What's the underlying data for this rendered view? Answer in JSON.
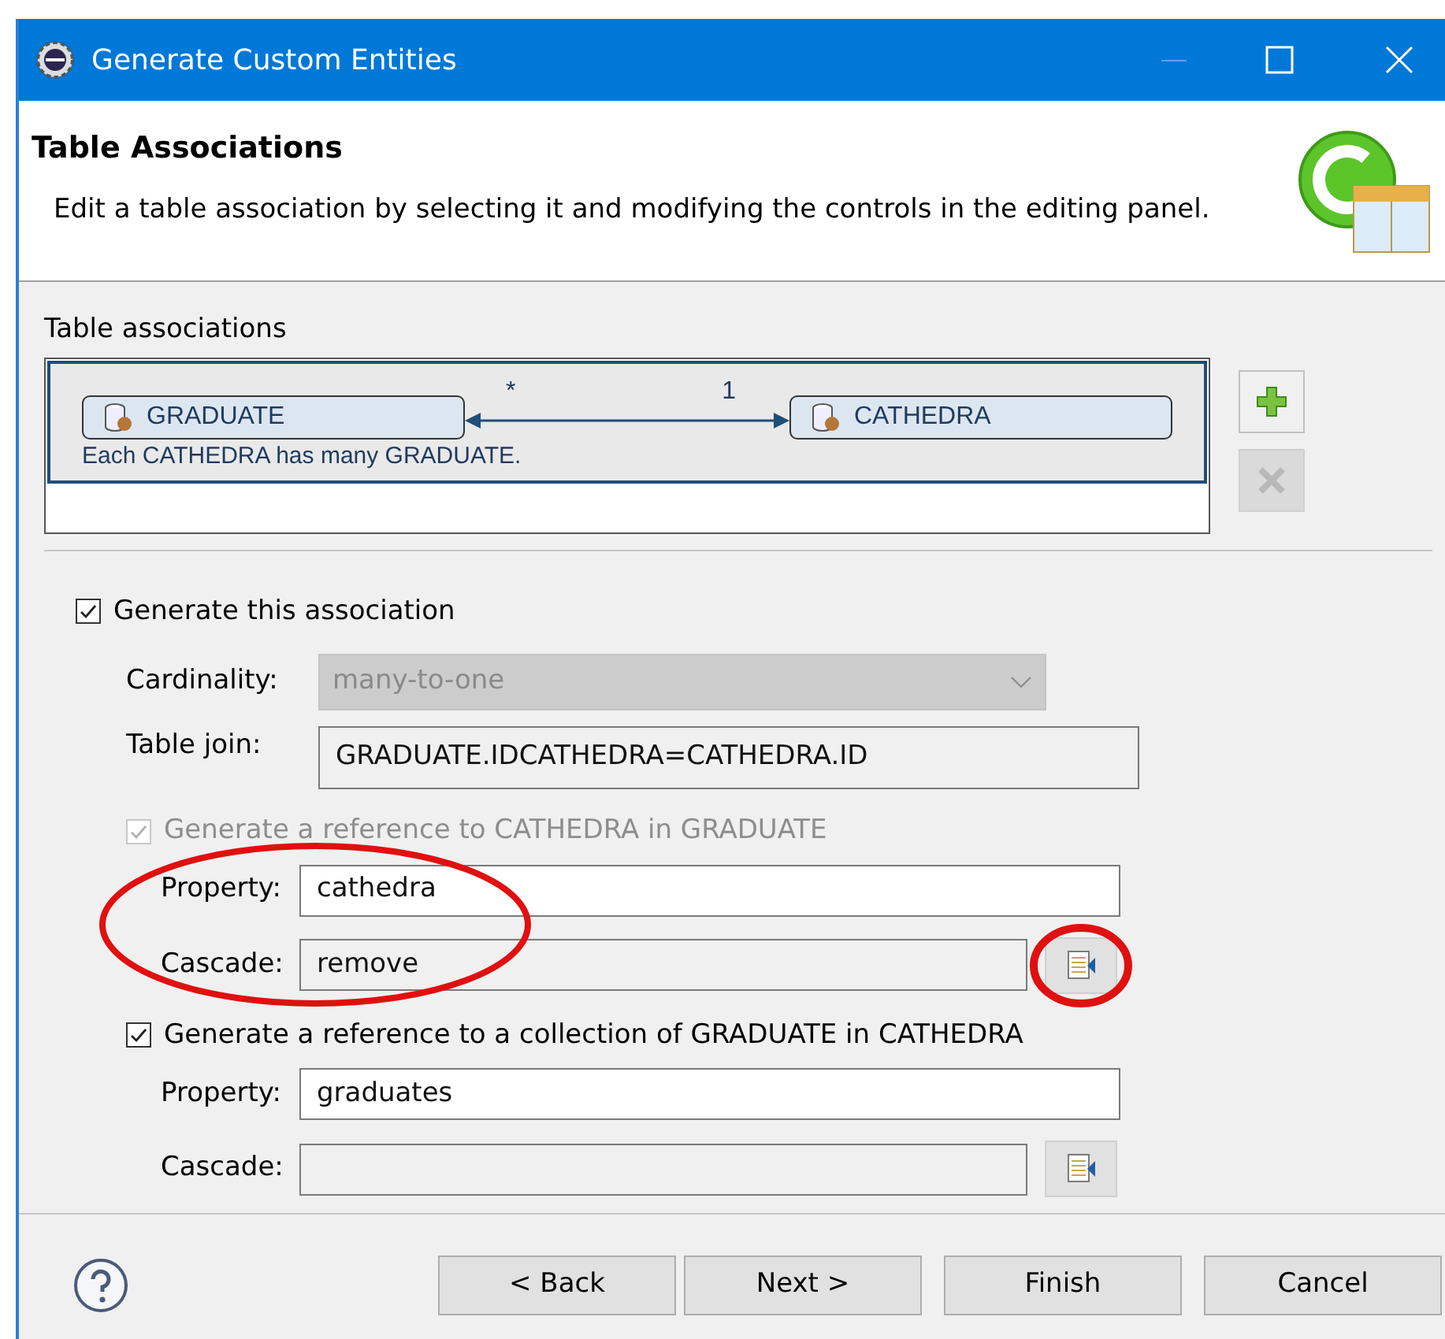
{
  "window": {
    "title": "Generate Custom Entities"
  },
  "header": {
    "title": "Table Associations",
    "description": "Edit a table association by selecting it and modifying the controls in the editing panel."
  },
  "associations": {
    "label": "Table associations",
    "items": [
      {
        "from": "GRADUATE",
        "to": "CATHEDRA",
        "from_cardinality": "*",
        "to_cardinality": "1",
        "summary": "Each CATHEDRA has many GRADUATE.",
        "selected": true
      }
    ],
    "add_disabled": false,
    "remove_disabled": true
  },
  "editor": {
    "generate": {
      "label": "Generate this association",
      "checked": true
    },
    "cardinality": {
      "label": "Cardinality:",
      "value": "many-to-one",
      "disabled": true
    },
    "table_join": {
      "label": "Table join:",
      "value": "GRADUATE.IDCATHEDRA=CATHEDRA.ID"
    },
    "references": [
      {
        "label": "Generate a reference to CATHEDRA in GRADUATE",
        "checked": true,
        "disabled": true,
        "property_label": "Property:",
        "property": "cathedra",
        "cascade_label": "Cascade:",
        "cascade": "remove",
        "highlighted": true
      },
      {
        "label": "Generate a reference to a collection of GRADUATE in CATHEDRA",
        "checked": true,
        "disabled": false,
        "property_label": "Property:",
        "property": "graduates",
        "cascade_label": "Cascade:",
        "highlighted": false
      }
    ]
  },
  "buttons": [
    {
      "label": "< Back"
    },
    {
      "label": "Next >"
    },
    {
      "label": "Finish"
    },
    {
      "label": "Cancel"
    }
  ]
}
